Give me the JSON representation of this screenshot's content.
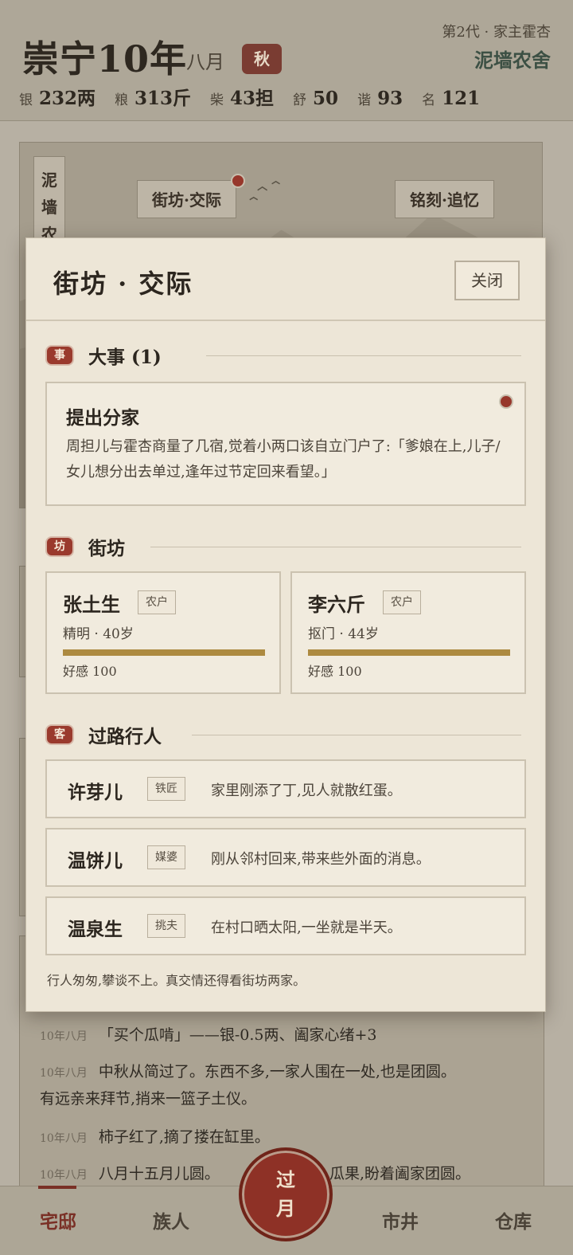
{
  "header": {
    "era": "崇宁10年",
    "month": "八月",
    "season": "秋",
    "generation": "第2代 · 家主霍杏",
    "household": "泥墙农舍",
    "stats": [
      {
        "key": "银",
        "value": "232两"
      },
      {
        "key": "粮",
        "value": "313斤"
      },
      {
        "key": "柴",
        "value": "43担"
      },
      {
        "key": "舒",
        "value": "50"
      },
      {
        "key": "谐",
        "value": "93"
      },
      {
        "key": "名",
        "value": "121"
      }
    ]
  },
  "scene": {
    "vertical_tag": "泥墙农",
    "tags": [
      "街坊·交际",
      "铭刻·追忆"
    ]
  },
  "log": [
    {
      "time": "10年八月",
      "text": "「买个瓜啃」——银-0.5两、阖家心绪+3"
    },
    {
      "time": "10年八月",
      "text": "中秋从简过了。东西不多,一家人围在一处,也是团圆。"
    },
    {
      "time": "",
      "text": "有远亲来拜节,捎来一篮子土仪。"
    },
    {
      "time": "10年八月",
      "text": "柿子红了,摘了搂在缸里。"
    },
    {
      "time": "10年八月",
      "text": "八月十五月儿圆。"
    },
    {
      "time": "",
      "text": "瓜果,盼着阖家团圆。"
    }
  ],
  "tabs": [
    "宅邸",
    "族人",
    "市井",
    "仓库"
  ],
  "next_month": {
    "line1": "过",
    "line2": "月"
  },
  "modal": {
    "title": "街坊 · 交际",
    "close_label": "关闭",
    "events_section": {
      "seal": "事",
      "title": "大事 (1)"
    },
    "event": {
      "title": "提出分家",
      "desc": "周担儿与霍杏商量了几宿,觉着小两口该自立门户了:「爹娘在上,儿子/女儿想分出去单过,逢年过节定回来看望。」"
    },
    "neighbors_section": {
      "seal": "坊",
      "title": "街坊"
    },
    "neighbors": [
      {
        "name": "张土生",
        "role": "农户",
        "meta": "精明 · 40岁",
        "favor_label": "好感 100",
        "favor": 100
      },
      {
        "name": "李六斤",
        "role": "农户",
        "meta": "抠门 · 44岁",
        "favor_label": "好感 100",
        "favor": 100
      }
    ],
    "passers_section": {
      "seal": "客",
      "title": "过路行人"
    },
    "passers": [
      {
        "name": "许芽儿",
        "role": "铁匠",
        "desc": "家里刚添了丁,见人就散红蛋。"
      },
      {
        "name": "温饼儿",
        "role": "媒婆",
        "desc": "刚从邻村回来,带来些外面的消息。"
      },
      {
        "name": "温泉生",
        "role": "挑夫",
        "desc": "在村口晒太阳,一坐就是半天。"
      }
    ],
    "footer": "行人匆匆,攀谈不上。真交情还得看街坊两家。"
  },
  "colors": {
    "accent_red": "#9a3a2d",
    "favor_bar": "#ad8a40",
    "paper": "#ede6d7"
  }
}
